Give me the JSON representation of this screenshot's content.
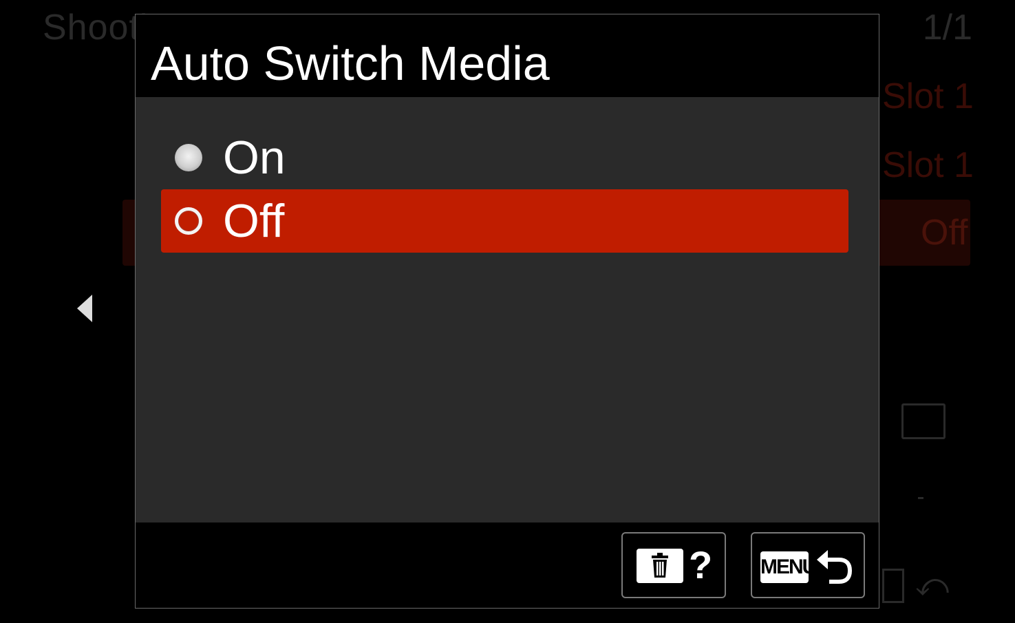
{
  "background": {
    "title": "Shooti",
    "page_indicator": "1/1",
    "row_values": [
      "Slot 1",
      "Slot 1"
    ],
    "highlighted_value": "Off"
  },
  "dialog": {
    "title": "Auto Switch Media",
    "options": [
      {
        "label": "On",
        "selected": false
      },
      {
        "label": "Off",
        "selected": true
      }
    ],
    "footer": {
      "help_symbol": "?",
      "menu_label": "MENU"
    }
  },
  "colors": {
    "selection": "#c01d00",
    "panel": "#2a2a2a",
    "background": "#000000"
  }
}
